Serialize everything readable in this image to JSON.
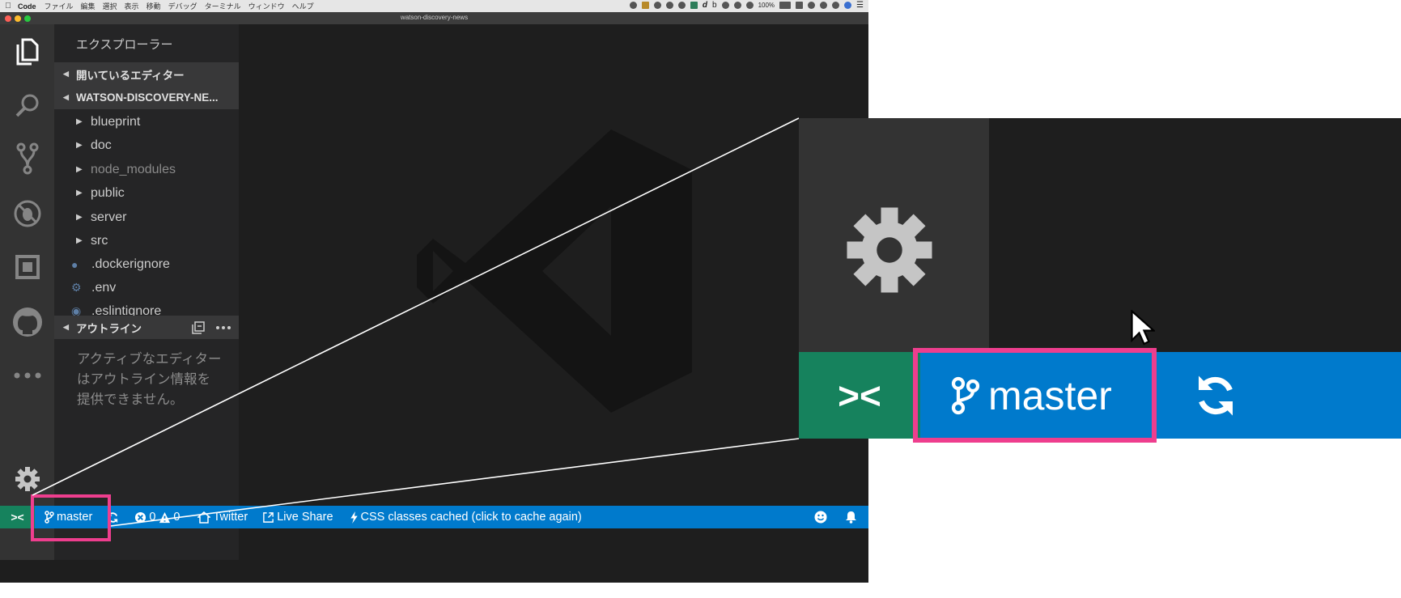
{
  "mac_menubar": {
    "app_name": "Code",
    "menus": [
      "ファイル",
      "編集",
      "選択",
      "表示",
      "移動",
      "デバッグ",
      "ターミナル",
      "ウィンドウ",
      "ヘルプ"
    ],
    "battery": "100%"
  },
  "window": {
    "title": "watson-discovery-news"
  },
  "activity_bar": {
    "items": [
      "explorer-icon",
      "search-icon",
      "source-control-icon",
      "debug-icon",
      "extensions-icon",
      "github-icon",
      "more-icon"
    ],
    "bottom": "gear-icon"
  },
  "sidebar": {
    "title": "エクスプローラー",
    "sections": {
      "open_editors": "開いているエディター",
      "workspace": "WATSON-DISCOVERY-NE...",
      "outline": "アウトライン"
    },
    "tree": [
      {
        "label": "blueprint",
        "type": "folder"
      },
      {
        "label": "doc",
        "type": "folder"
      },
      {
        "label": "node_modules",
        "type": "folder"
      },
      {
        "label": "public",
        "type": "folder"
      },
      {
        "label": "server",
        "type": "folder"
      },
      {
        "label": "src",
        "type": "folder"
      },
      {
        "label": ".dockerignore",
        "type": "file"
      },
      {
        "label": ".env",
        "type": "file"
      },
      {
        "label": ".eslintignore",
        "type": "file"
      }
    ],
    "outline_message": "アクティブなエディターはアウトライン情報を提供できません。"
  },
  "status_bar": {
    "remote": "><",
    "branch": "master",
    "errors": "0",
    "warnings": "0",
    "twitter": "Twitter",
    "live_share": "Live Share",
    "css": "CSS classes cached (click to cache again)"
  },
  "zoom": {
    "remote": "><",
    "branch": "master"
  },
  "colors": {
    "status_bar": "#007acc",
    "remote": "#16825d",
    "highlight": "#ee3e8e"
  }
}
